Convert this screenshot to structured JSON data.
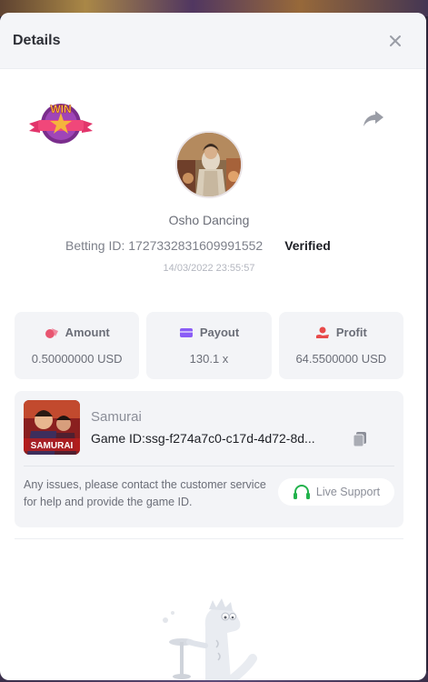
{
  "modal": {
    "title": "Details",
    "close_icon": "close-icon"
  },
  "header": {
    "badge_text": "WIN",
    "share_icon": "share-icon"
  },
  "user": {
    "name": "Osho Dancing",
    "betting_id": "Betting ID: 1727332831609991552",
    "verified_label": "Verified",
    "timestamp": "14/03/2022 23:55:57"
  },
  "stats": [
    {
      "label": "Amount",
      "value": "0.50000000 USD",
      "icon": "coins-icon",
      "color": "#e85570"
    },
    {
      "label": "Payout",
      "value": "130.1 x",
      "icon": "card-icon",
      "color": "#8a5cf6"
    },
    {
      "label": "Profit",
      "value": "64.5500000 USD",
      "icon": "hand-coin-icon",
      "color": "#e84a4a"
    }
  ],
  "game": {
    "thumb_text": "SAMURAI",
    "name": "Samurai",
    "id": "Game ID:ssg-f274a7c0-c17d-4d72-8d...",
    "copy_icon": "copy-icon",
    "issue_text": "Any issues, please contact the customer service for help and provide the game ID.",
    "support_label": "Live Support",
    "support_icon": "headset-icon",
    "support_color": "#22b24c"
  },
  "colors": {
    "accent_green": "#22b24c",
    "text_dark": "#1d1f25",
    "text_muted": "#6b6e78",
    "card_bg": "#f3f4f7"
  }
}
